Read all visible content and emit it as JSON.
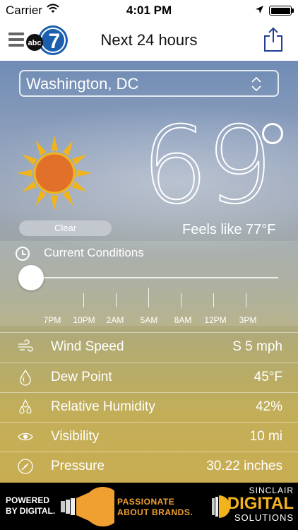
{
  "status_bar": {
    "carrier": "Carrier",
    "time": "4:01 PM",
    "icons": [
      "wifi-icon",
      "location-arrow-icon",
      "battery-icon"
    ]
  },
  "nav": {
    "title": "Next 24 hours",
    "logo_text": "abc",
    "logo_number": "7",
    "menu_icon": "hamburger-icon",
    "share_icon": "share-icon"
  },
  "location": {
    "selected": "Washington, DC"
  },
  "current": {
    "temperature": "69",
    "condition": "Clear",
    "feels_like": "Feels like  77°F",
    "icon": "sun-icon"
  },
  "timeline": {
    "title": "Current Conditions",
    "slider_position": 0,
    "labels": [
      "7PM",
      "10PM",
      "2AM",
      "5AM",
      "8AM",
      "12PM",
      "3PM"
    ]
  },
  "details": [
    {
      "label": "Wind Speed",
      "value": "S 5 mph",
      "icon": "wind-icon"
    },
    {
      "label": "Dew Point",
      "value": "45°F",
      "icon": "droplet-icon"
    },
    {
      "label": "Relative Humidity",
      "value": "42%",
      "icon": "humidity-drops-icon"
    },
    {
      "label": "Visibility",
      "value": "10 mi",
      "icon": "eye-icon"
    },
    {
      "label": "Pressure",
      "value": "30.22 inches",
      "icon": "gauge-icon"
    }
  ],
  "ad": {
    "powered_line1": "POWERED",
    "powered_line2": "BY DIGITAL.",
    "tagline_line1": "PASSIONATE",
    "tagline_line2": "ABOUT BRANDS.",
    "brand_line1": "SINCLAIR",
    "brand_line2": "DIGITAL",
    "brand_line3": "SOLUTIONS"
  },
  "colors": {
    "sun_core": "#e0702a",
    "sun_rays": "#f0b41c",
    "ad_orange": "#f0a030",
    "ad_gold": "#f2b41e"
  }
}
